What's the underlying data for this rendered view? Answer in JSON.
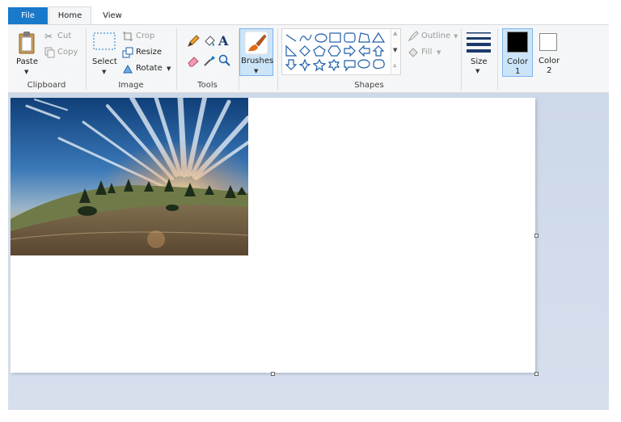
{
  "tabs": {
    "file": "File",
    "home": "Home",
    "view": "View"
  },
  "clipboard": {
    "paste": "Paste",
    "cut": "Cut",
    "copy": "Copy",
    "group": "Clipboard"
  },
  "image": {
    "select": "Select",
    "crop": "Crop",
    "resize": "Resize",
    "rotate": "Rotate",
    "group": "Image"
  },
  "tools": {
    "group": "Tools"
  },
  "brushes": {
    "label": "Brushes"
  },
  "shapes": {
    "outline": "Outline",
    "fill": "Fill",
    "group": "Shapes"
  },
  "size": {
    "label": "Size"
  },
  "colors": {
    "color1_a": "Color",
    "color1_b": "1",
    "color2_a": "Color",
    "color2_b": "2",
    "color1_value": "#000000",
    "color2_value": "#ffffff"
  },
  "accent": "#1979ca"
}
